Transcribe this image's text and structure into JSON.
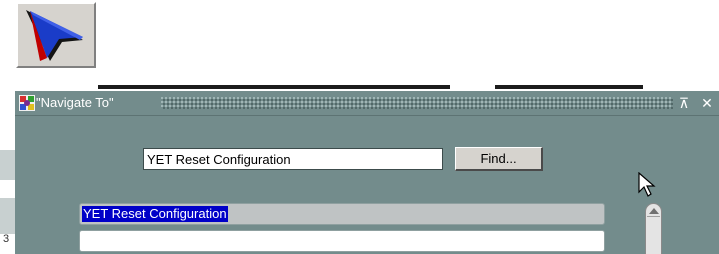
{
  "toolbar": {
    "navigate_icon": "navigate-arrow-icon"
  },
  "dialog": {
    "title": "\"Navigate To\"",
    "title_icon": "window-app-icon",
    "minimize_icon": "collapse-icon",
    "close_icon": "close-icon",
    "minimize_glyph": "⊼",
    "close_glyph": "✕"
  },
  "search": {
    "value": "YET Reset Configuration",
    "find_label": "Find..."
  },
  "results": {
    "selected_item": "YET Reset Configuration",
    "empty_item": ""
  },
  "scrollbar": {
    "up_icon": "scroll-up-icon"
  },
  "background": {
    "left_char": "3"
  },
  "colors": {
    "window_bg": "#738c8c",
    "selection": "#0000c8",
    "button_face": "#d6d3ce"
  }
}
